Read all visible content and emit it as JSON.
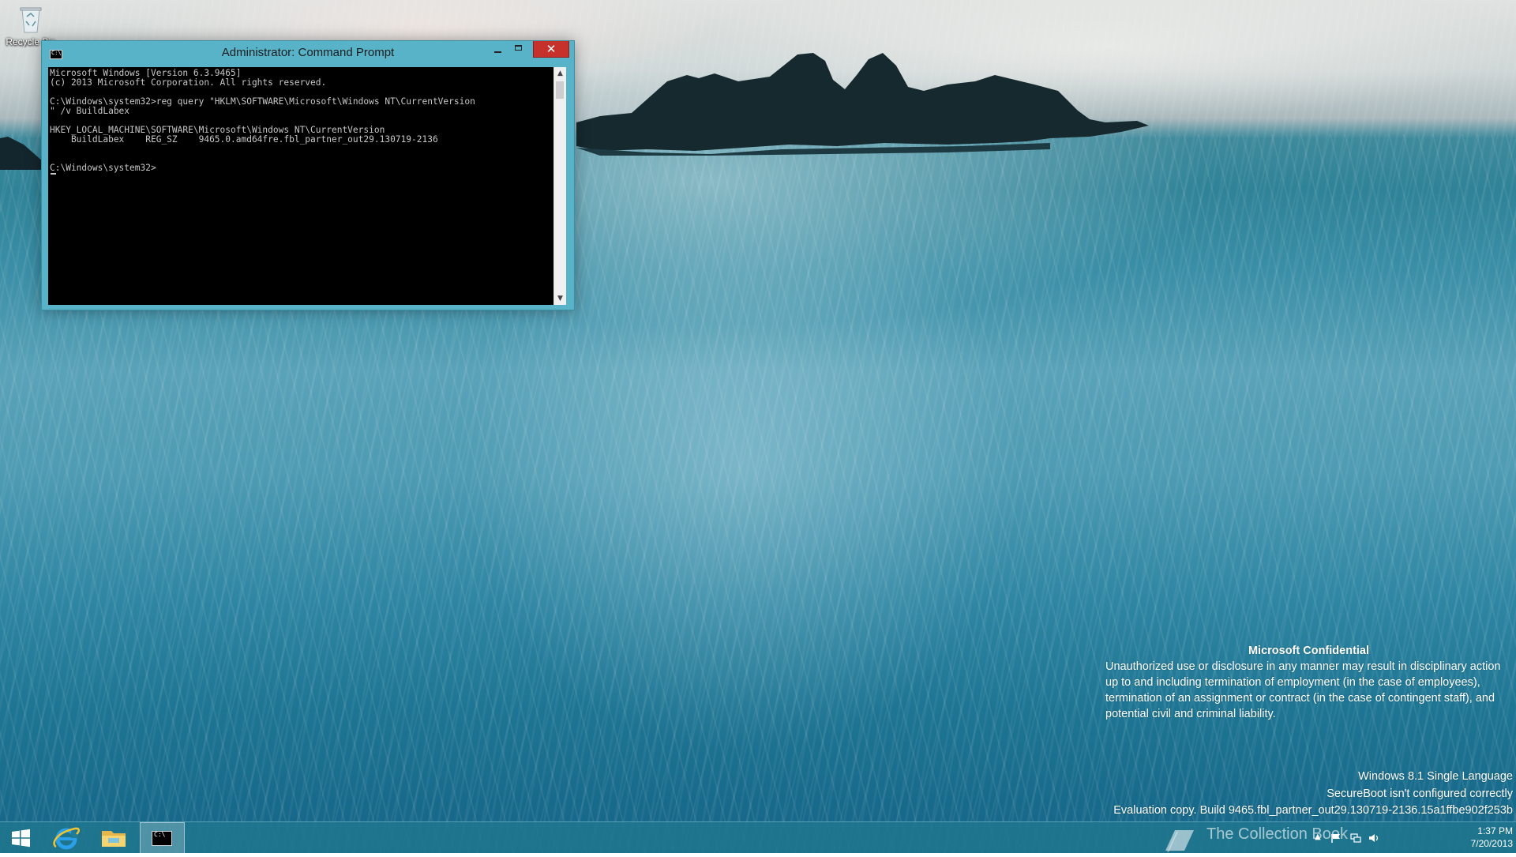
{
  "desktop": {
    "icons": [
      {
        "label": "Recycle Bin",
        "icon": "recycle-bin-icon"
      }
    ]
  },
  "cmd_window": {
    "title": "Administrator: Command Prompt",
    "icon": "cmd-icon",
    "icon_glyph": "C:\\",
    "close_glyph": "✕",
    "output_lines": [
      "Microsoft Windows [Version 6.3.9465]",
      "(c) 2013 Microsoft Corporation. All rights reserved.",
      "",
      "C:\\Windows\\system32>reg query \"HKLM\\SOFTWARE\\Microsoft\\Windows NT\\CurrentVersion",
      "\" /v BuildLabex",
      "",
      "HKEY_LOCAL_MACHINE\\SOFTWARE\\Microsoft\\Windows NT\\CurrentVersion",
      "    BuildLabex    REG_SZ    9465.0.amd64fre.fbl_partner_out29.130719-2136",
      "",
      "",
      "C:\\Windows\\system32>"
    ]
  },
  "watermark": {
    "title": "Microsoft Confidential",
    "body": "Unauthorized use or disclosure in any manner may result in disciplinary action up to and including termination of employment (in the case of employees), termination of an assignment or contract (in the case of contingent staff), and potential civil and criminal liability.",
    "edition": "Windows 8.1 Single Language",
    "secureboot": "SecureBoot isn't configured correctly",
    "build": "Evaluation copy. Build 9465.fbl_partner_out29.130719-2136.15a1ffbe902f253b"
  },
  "taskbar": {
    "items": [
      {
        "name": "start",
        "icon": "windows-logo-icon"
      },
      {
        "name": "internet-explorer",
        "icon": "internet-explorer-icon"
      },
      {
        "name": "file-explorer",
        "icon": "folder-icon"
      },
      {
        "name": "command-prompt",
        "icon": "cmd-icon",
        "glyph": "C:\\",
        "active": true
      }
    ],
    "tray": {
      "overlay_text": "The Collection Book",
      "arrow_glyph": "▲",
      "icons": [
        "flag-icon",
        "network-icon",
        "volume-icon"
      ],
      "time": "1:37 PM",
      "date": "7/20/2013"
    }
  },
  "colors": {
    "titlebar": "#58b3c9",
    "close_button": "#c7312b",
    "console_bg": "#000000",
    "console_text": "#c7c7c7",
    "taskbar": "#20768e"
  }
}
